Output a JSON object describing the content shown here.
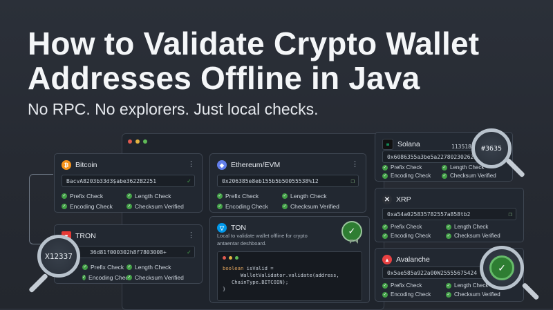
{
  "header": {
    "title": "How to Validate Crypto Wallet Addresses Offline in Java",
    "subtitle": "No RPC. No explorers. Just local checks."
  },
  "colors": {
    "valid": "#43a047",
    "btc": "#f7931a",
    "eth": "#627eea",
    "tron": "#e53935",
    "ton": "#0098ea",
    "sol": "#14f195",
    "avax": "#e84142"
  },
  "checks": {
    "prefix": "Prefix Check",
    "length": "Length Check",
    "encoding": "Encoding Check",
    "checksum": "Checksum Verified"
  },
  "cards": {
    "bitcoin": {
      "name": "Bitcoin",
      "icon": "bitcoin-icon",
      "address": "BacvA8203b33d3$abe3622B2251"
    },
    "ethereum": {
      "name": "Ethereum/EVM",
      "icon": "ethereum-icon",
      "address": "0x206385e8eb155b5b50055538%12"
    },
    "tron": {
      "name": "TRON",
      "icon": "tron-icon",
      "address": "36d81f000302h8f7803008+",
      "magnifier_text": "X12337"
    },
    "ton": {
      "name": "TON",
      "icon": "ton-icon",
      "description": "Local to validate wallet offline for crypto antaentar deshboard.",
      "code": {
        "line1_kw": "boolean",
        "line1_rest": " isValid =",
        "line2": "      WalletValidator.validate(address,",
        "line3": "   ChainType.BITCOIN);",
        "line4": "}"
      }
    },
    "solana": {
      "name": "Solana",
      "icon": "solana-icon",
      "address": "0x6086355a3be5a227802302620",
      "magnifier_text": "1135186e",
      "magnifier_text2": "#3635"
    },
    "xrp": {
      "name": "XRP",
      "icon": "xrp-icon",
      "address": "0xa54a025835782557a858tb2"
    },
    "avalanche": {
      "name": "Avalanche",
      "icon": "avalanche-icon",
      "address": "0x5ae585a922a00W25555675424"
    }
  }
}
